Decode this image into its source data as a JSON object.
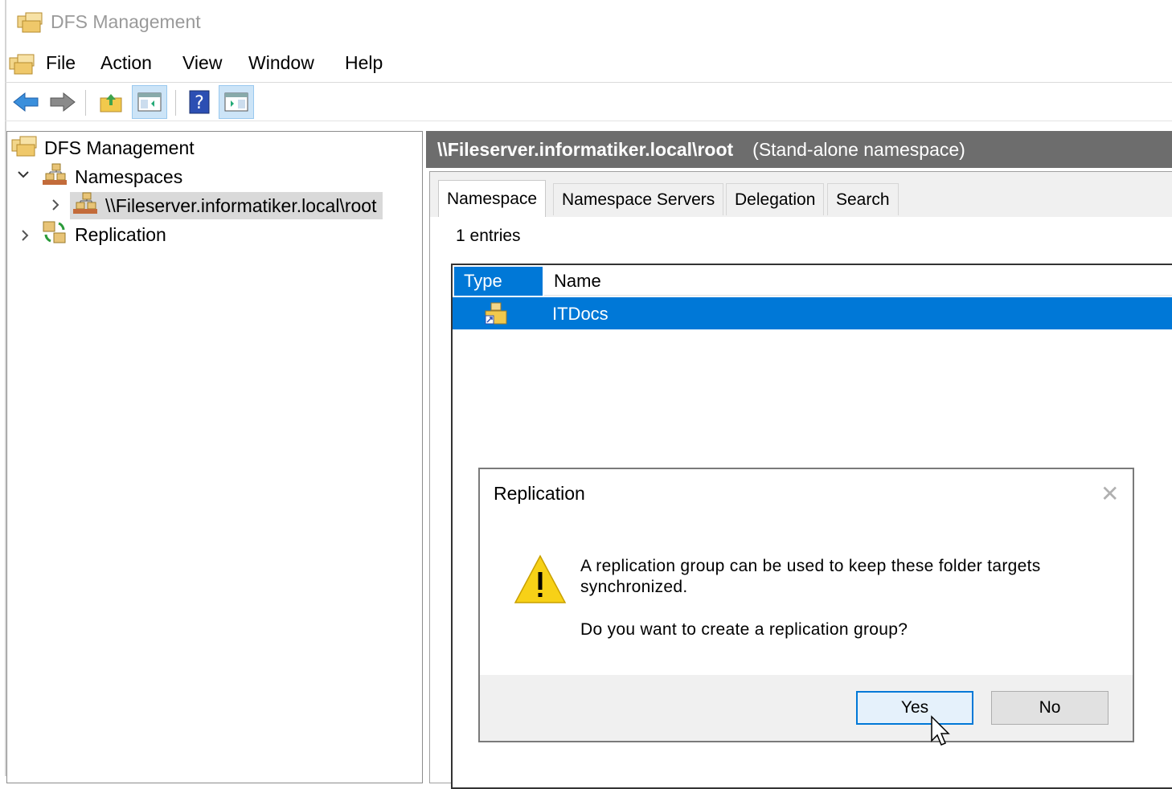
{
  "window": {
    "title": "DFS Management"
  },
  "menubar": {
    "items": [
      "File",
      "Action",
      "View",
      "Window",
      "Help"
    ]
  },
  "toolbar": {
    "icons": [
      "back-arrow-icon",
      "forward-arrow-icon",
      "up-folder-icon",
      "show-hide-console-tree-icon",
      "help-icon",
      "show-hide-action-pane-icon"
    ]
  },
  "tree": {
    "root": "DFS Management",
    "namespaces": "Namespaces",
    "namespace_root": "\\\\Fileserver.informatiker.local\\root",
    "replication": "Replication"
  },
  "details": {
    "header_path": "\\\\Fileserver.informatiker.local\\root",
    "header_type": "(Stand-alone namespace)",
    "tabs": [
      "Namespace",
      "Namespace Servers",
      "Delegation",
      "Search"
    ],
    "active_tab": "Namespace",
    "entries_count": "1 entries",
    "columns": [
      "Type",
      "Name"
    ],
    "rows": [
      {
        "name": "ITDocs",
        "type_icon": "folder-link-icon",
        "selected": true
      }
    ]
  },
  "dialog": {
    "title": "Replication",
    "message": "A replication group can be used to keep these folder targets synchronized.",
    "question": "Do you want to create a replication group?",
    "yes_label": "Yes",
    "no_label": "No",
    "close_glyph": "✕",
    "icon": "warning-icon"
  },
  "colors": {
    "selection": "#0078d7",
    "header_bar": "#6d6d6d",
    "warning": "#f7d117"
  }
}
